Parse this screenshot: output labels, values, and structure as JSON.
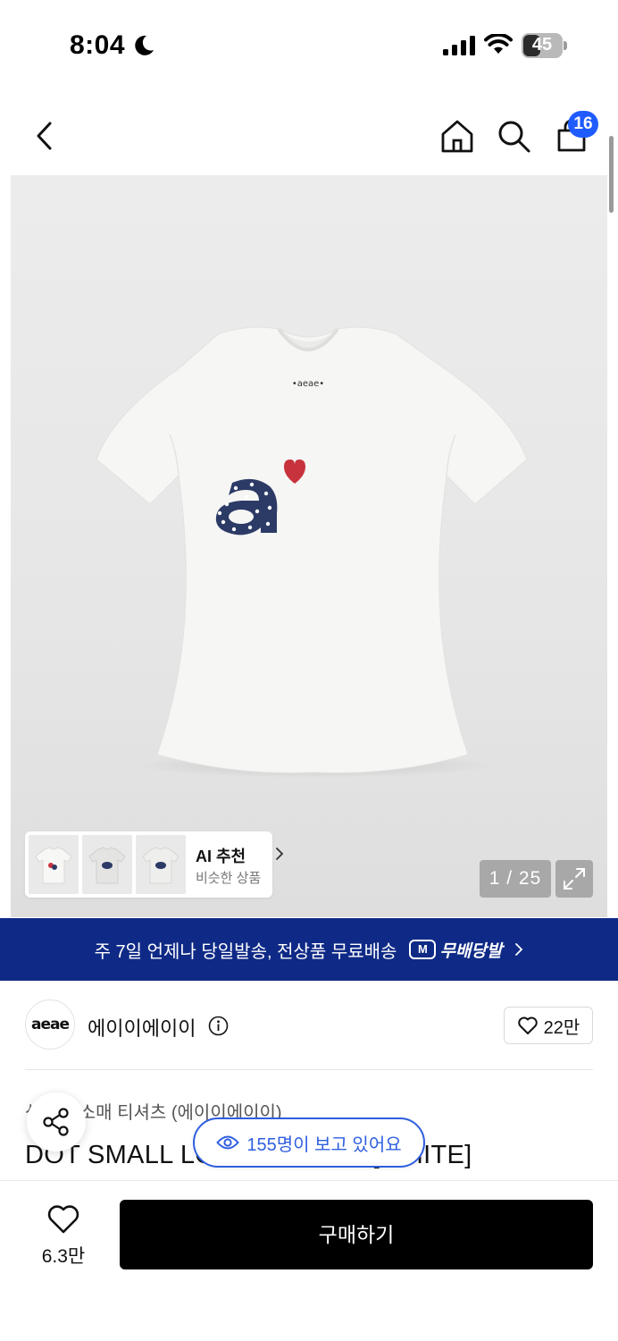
{
  "status_bar": {
    "time": "8:04",
    "battery": "45",
    "battery_fill_fraction": 0.45
  },
  "header": {
    "cart_count": "16"
  },
  "gallery": {
    "ai_recommend": {
      "title": "AI 추천",
      "subtitle": "비슷한 상품"
    },
    "counter": "1 / 25"
  },
  "banner": {
    "text": "주 7일 언제나 당일발송, 전상품 무료배송",
    "logo_mark": "M",
    "logo_name": "무배당발"
  },
  "brand": {
    "logo_text": "aeae",
    "name": "에이이에이이",
    "likes": "22만"
  },
  "product": {
    "category": "상의  반소매 티셔츠 (에이이에이이)",
    "title": "DOT SMALL LOGO T-SHIRT [WHITE]"
  },
  "viewers": "155명이 보고 있어요",
  "bottom": {
    "wish_count": "6.3만",
    "buy_label": "구매하기"
  },
  "colors": {
    "accent": "#1f5cff",
    "banner": "#0f2a86",
    "buy_button": "#000000",
    "viewer_pill": "#2f5fe0"
  }
}
